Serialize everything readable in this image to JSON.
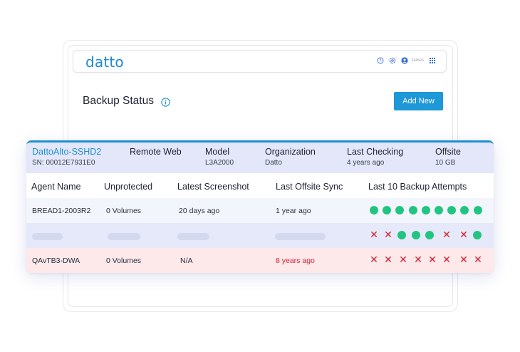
{
  "app": {
    "logo_text": "datto",
    "user_name": "James",
    "brand_color": "#1e98d6",
    "icons": [
      "help-icon",
      "settings-icon",
      "user-icon",
      "apps-grid-icon"
    ]
  },
  "page": {
    "title": "Backup Status",
    "add_button": "Add New"
  },
  "device": {
    "name": "DattoAlto-SSHD2",
    "serial": "SN: 00012E7931E0",
    "remote_web_label": "Remote Web",
    "model_label": "Model",
    "model_value": "L3A2000",
    "organization_label": "Organization",
    "organization_value": "Datto",
    "last_checking_label": "Last Checking",
    "last_checking_value": "4 years ago",
    "offsite_label": "Offsite",
    "offsite_value": "10 GB"
  },
  "table": {
    "columns": [
      "Agent Name",
      "Unprotected",
      "Latest Screenshot",
      "Last Offsite Sync",
      "Last 10 Backup Attempts"
    ],
    "rows": [
      {
        "agent": "BREAD1-2003R2",
        "unprotected": "0 Volumes",
        "screenshot": "20 days ago",
        "offsite_sync": "1 year ago",
        "attempts": [
          "ok",
          "ok",
          "ok",
          "ok",
          "ok",
          "ok",
          "ok",
          "ok",
          "ok"
        ]
      },
      {
        "agent": "",
        "unprotected": "",
        "screenshot": "",
        "offsite_sync": "",
        "attempts": [
          "fail",
          "fail",
          "ok",
          "ok",
          "ok",
          "fail",
          "fail",
          "ok"
        ]
      },
      {
        "agent": "QAvTB3-DWA",
        "unprotected": "0 Volumes",
        "screenshot": "N/A",
        "offsite_sync": "8 years ago",
        "attempts": [
          "fail",
          "fail",
          "fail",
          "fail",
          "fail",
          "fail",
          "fail",
          "fail"
        ]
      }
    ]
  },
  "colors": {
    "success": "#22c482",
    "failure": "#d6202c",
    "accent": "#1e8fd2"
  }
}
